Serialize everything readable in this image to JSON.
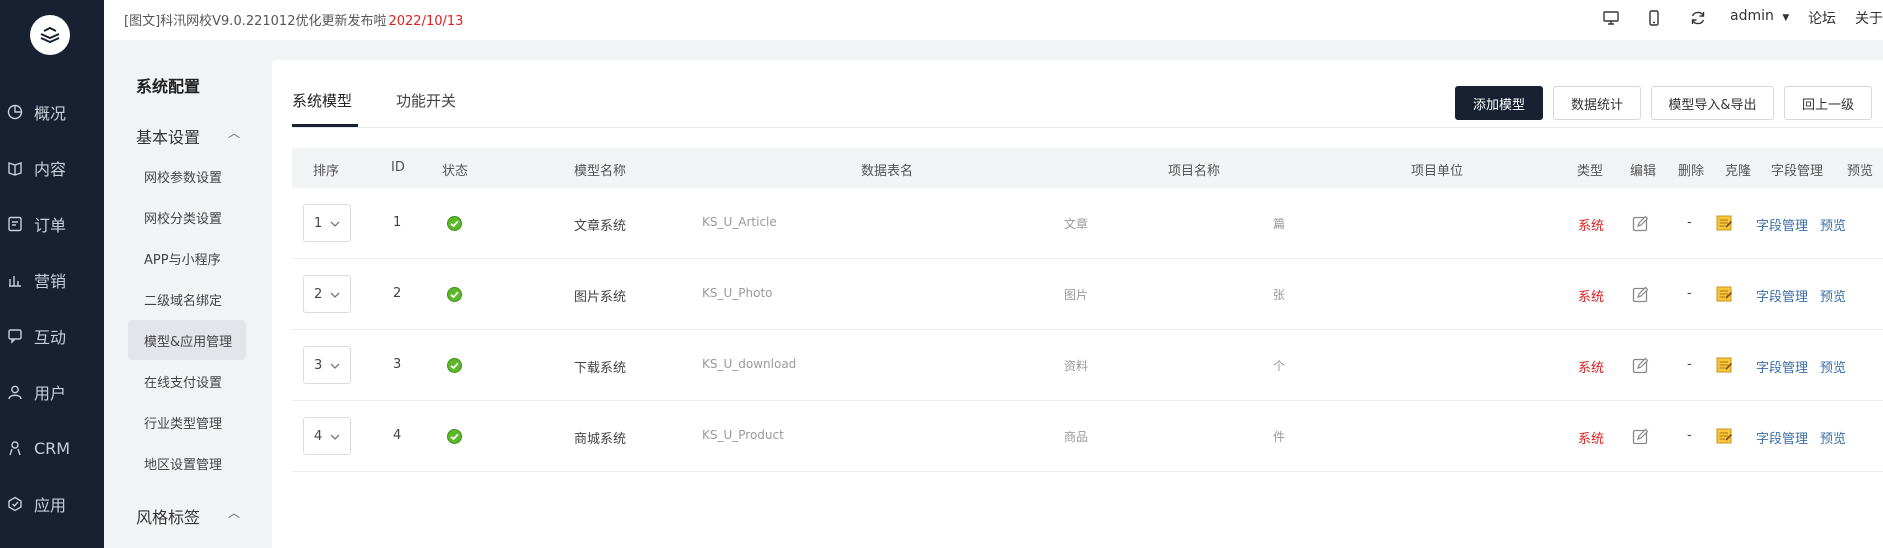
{
  "nav": {
    "items": [
      {
        "label": "概况",
        "icon": "pie-chart-icon"
      },
      {
        "label": "内容",
        "icon": "book-icon"
      },
      {
        "label": "订单",
        "icon": "order-icon"
      },
      {
        "label": "营销",
        "icon": "marketing-icon"
      },
      {
        "label": "互动",
        "icon": "chat-icon"
      },
      {
        "label": "用户",
        "icon": "user-icon"
      },
      {
        "label": "CRM",
        "icon": "crm-icon"
      },
      {
        "label": "应用",
        "icon": "app-icon"
      }
    ]
  },
  "topbar": {
    "notice_text": "[图文]科汛网校V9.0.221012优化更新发布啦",
    "notice_date": "2022/10/13",
    "user": "admin",
    "forum": "论坛",
    "about": "关于"
  },
  "sidebar": {
    "title": "系统配置",
    "group1": "基本设置",
    "items": [
      "网校参数设置",
      "网校分类设置",
      "APP与小程序",
      "二级域名绑定",
      "模型&应用管理",
      "在线支付设置",
      "行业类型管理",
      "地区设置管理"
    ],
    "group2": "风格标签"
  },
  "tabs": {
    "active": "系统模型",
    "other": "功能开关"
  },
  "buttons": {
    "add": "添加模型",
    "stats": "数据统计",
    "import_export": "模型导入&导出",
    "back": "回上一级"
  },
  "table": {
    "headers": {
      "sort": "排序",
      "id": "ID",
      "status": "状态",
      "name": "模型名称",
      "table": "数据表名",
      "item_name": "项目名称",
      "item_unit": "项目单位",
      "type": "类型",
      "edit": "编辑",
      "delete": "删除",
      "clone": "克隆",
      "fields": "字段管理",
      "preview": "预览"
    },
    "rows": [
      {
        "sort": "1",
        "id": "1",
        "name": "文章系统",
        "table": "KS_U_Article",
        "item_name": "文章",
        "unit": "篇",
        "type": "系统",
        "delete": "-",
        "fields": "字段管理",
        "preview": "预览"
      },
      {
        "sort": "2",
        "id": "2",
        "name": "图片系统",
        "table": "KS_U_Photo",
        "item_name": "图片",
        "unit": "张",
        "type": "系统",
        "delete": "-",
        "fields": "字段管理",
        "preview": "预览"
      },
      {
        "sort": "3",
        "id": "3",
        "name": "下载系统",
        "table": "KS_U_download",
        "item_name": "资料",
        "unit": "个",
        "type": "系统",
        "delete": "-",
        "fields": "字段管理",
        "preview": "预览"
      },
      {
        "sort": "4",
        "id": "4",
        "name": "商城系统",
        "table": "KS_U_Product",
        "item_name": "商品",
        "unit": "件",
        "type": "系统",
        "delete": "-",
        "fields": "字段管理",
        "preview": "预览"
      }
    ]
  },
  "colors": {
    "nav_bg": "#172132",
    "accent": "#172132",
    "system_red": "#e02020",
    "link_blue": "#3a6ea5",
    "status_green": "#5cb82a"
  }
}
